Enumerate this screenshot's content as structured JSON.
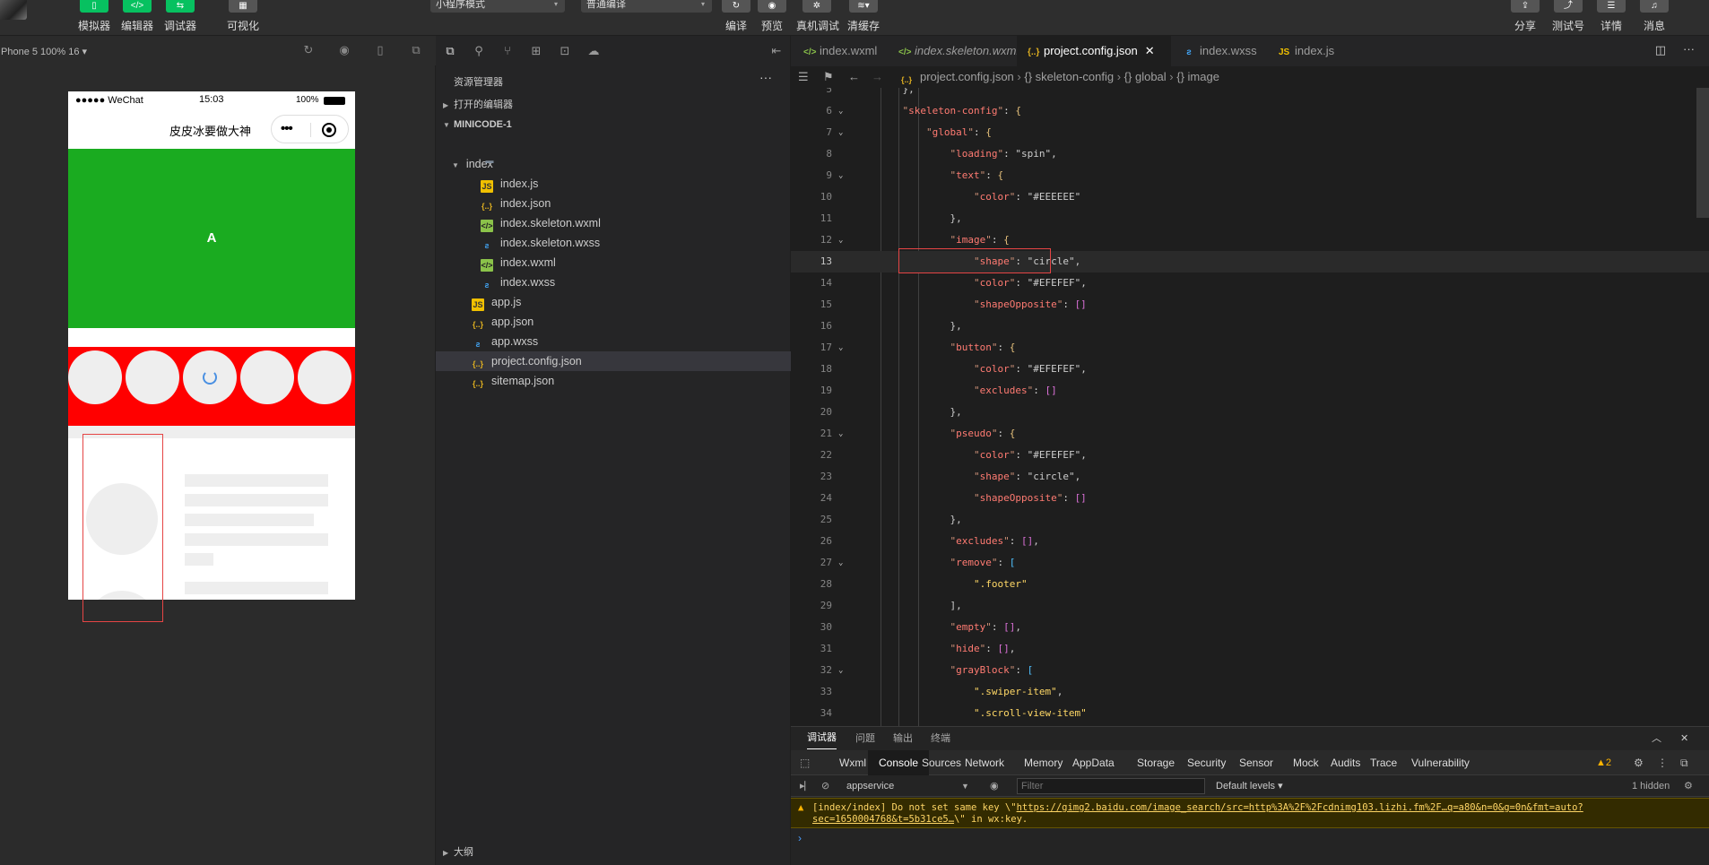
{
  "toolbar": {
    "left_buttons": [
      {
        "label": "模拟器",
        "icon": "phone-icon"
      },
      {
        "label": "编辑器",
        "icon": "code-icon"
      },
      {
        "label": "调试器",
        "icon": "debugger-icon"
      },
      {
        "label": "可视化",
        "icon": "visual-icon"
      }
    ],
    "mode_select": "小程序模式",
    "compile_select": "普通编译",
    "mid_buttons": [
      {
        "label": "编译",
        "icon": "refresh-icon"
      },
      {
        "label": "预览",
        "icon": "eye-icon"
      },
      {
        "label": "真机调试",
        "icon": "bug-icon"
      },
      {
        "label": "清缓存",
        "icon": "layers-icon"
      }
    ],
    "right_buttons": [
      {
        "label": "分享",
        "icon": "share-icon"
      },
      {
        "label": "测试号",
        "icon": "external-icon"
      },
      {
        "label": "详情",
        "icon": "menu-icon"
      },
      {
        "label": "消息",
        "icon": "bell-icon"
      }
    ]
  },
  "simulator": {
    "device": "Phone 5 100% 16 ▾",
    "status": {
      "carrier": "●●●●● WeChat",
      "time": "15:03",
      "battery": "100%"
    },
    "nav_title": "皮皮冰要做大神",
    "swiper_text": "A"
  },
  "explorer": {
    "title": "资源管理器",
    "open_editors": "打开的编辑器",
    "project": "MINICODE-1",
    "outline": "大纲",
    "tree": [
      {
        "name": "index",
        "type": "fold",
        "indent": 1
      },
      {
        "name": "index.js",
        "type": "js",
        "indent": 2
      },
      {
        "name": "index.json",
        "type": "json",
        "indent": 2
      },
      {
        "name": "index.skeleton.wxml",
        "type": "wxml",
        "indent": 2
      },
      {
        "name": "index.skeleton.wxss",
        "type": "wxss",
        "indent": 2
      },
      {
        "name": "index.wxml",
        "type": "wxml",
        "indent": 2
      },
      {
        "name": "index.wxss",
        "type": "wxss",
        "indent": 2
      },
      {
        "name": "app.js",
        "type": "js",
        "indent": 1
      },
      {
        "name": "app.json",
        "type": "json",
        "indent": 1
      },
      {
        "name": "app.wxss",
        "type": "wxss",
        "indent": 1
      },
      {
        "name": "project.config.json",
        "type": "json",
        "indent": 1,
        "selected": true
      },
      {
        "name": "sitemap.json",
        "type": "json",
        "indent": 1
      }
    ]
  },
  "editor": {
    "tabs": [
      {
        "name": "index.wxml",
        "type": "wxml"
      },
      {
        "name": "index.skeleton.wxml",
        "type": "wxml"
      },
      {
        "name": "project.config.json",
        "type": "json",
        "active": true
      },
      {
        "name": "index.wxss",
        "type": "wxss"
      },
      {
        "name": "index.js",
        "type": "js"
      }
    ],
    "breadcrumb": [
      "project.config.json",
      "{} skeleton-config",
      "{} global",
      "{} image"
    ],
    "current_line": 13,
    "lines": [
      {
        "n": 5,
        "t": "    },"
      },
      {
        "n": 6,
        "t": "    \"skeleton-config\": {",
        "fold": true
      },
      {
        "n": 7,
        "t": "        \"global\": {",
        "fold": true
      },
      {
        "n": 8,
        "t": "            \"loading\": \"spin\","
      },
      {
        "n": 9,
        "t": "            \"text\": {",
        "fold": true
      },
      {
        "n": 10,
        "t": "                \"color\": \"#EEEEEE\""
      },
      {
        "n": 11,
        "t": "            },"
      },
      {
        "n": 12,
        "t": "            \"image\": {",
        "fold": true
      },
      {
        "n": 13,
        "t": "                \"shape\": \"circle\","
      },
      {
        "n": 14,
        "t": "                \"color\": \"#EFEFEF\","
      },
      {
        "n": 15,
        "t": "                \"shapeOpposite\": []"
      },
      {
        "n": 16,
        "t": "            },"
      },
      {
        "n": 17,
        "t": "            \"button\": {",
        "fold": true
      },
      {
        "n": 18,
        "t": "                \"color\": \"#EFEFEF\","
      },
      {
        "n": 19,
        "t": "                \"excludes\": []"
      },
      {
        "n": 20,
        "t": "            },"
      },
      {
        "n": 21,
        "t": "            \"pseudo\": {",
        "fold": true
      },
      {
        "n": 22,
        "t": "                \"color\": \"#EFEFEF\","
      },
      {
        "n": 23,
        "t": "                \"shape\": \"circle\","
      },
      {
        "n": 24,
        "t": "                \"shapeOpposite\": []"
      },
      {
        "n": 25,
        "t": "            },"
      },
      {
        "n": 26,
        "t": "            \"excludes\": [],"
      },
      {
        "n": 27,
        "t": "            \"remove\": [",
        "fold": true
      },
      {
        "n": 28,
        "t": "                \".footer\""
      },
      {
        "n": 29,
        "t": "            ],"
      },
      {
        "n": 30,
        "t": "            \"empty\": [],"
      },
      {
        "n": 31,
        "t": "            \"hide\": [],"
      },
      {
        "n": 32,
        "t": "            \"grayBlock\": [",
        "fold": true
      },
      {
        "n": 33,
        "t": "                \".swiper-item\","
      },
      {
        "n": 34,
        "t": "                \".scroll-view-item\""
      }
    ]
  },
  "devtools": {
    "panel_tabs": [
      "调试器",
      "问题",
      "输出",
      "终端"
    ],
    "tabs": [
      "Wxml",
      "Console",
      "Sources",
      "Network",
      "Memory",
      "AppData",
      "Storage",
      "Security",
      "Sensor",
      "Mock",
      "Audits",
      "Trace",
      "Vulnerability"
    ],
    "active_tab": "Console",
    "warn_count": "2",
    "context": "appservice",
    "filter_placeholder": "Filter",
    "levels": "Default levels ▾",
    "hidden": "1 hidden",
    "warning_prefix": "[index/index] Do not set same key \\\"",
    "warning_link": "https://gimg2.baidu.com/image_search/src=http%3A%2F%2Fcdnimg103.lizhi.fm%2F…q=a80&n=0&g=0n&fmt=auto?sec=1650004768&t=5b31ce5…",
    "warning_suffix": "\\\" in wx:key."
  }
}
